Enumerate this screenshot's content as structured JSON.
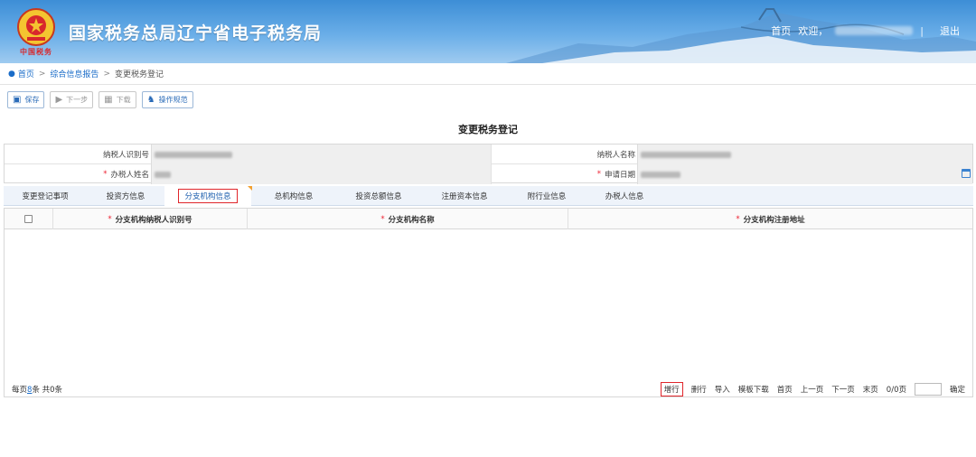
{
  "header": {
    "title": "国家税务总局辽宁省电子税务局",
    "logo_text": "中国税务",
    "home": "首页",
    "welcome": "欢迎，",
    "logout": "退出",
    "separator": "|"
  },
  "breadcrumb": {
    "home": "首页",
    "parent": "综合信息报告",
    "current": "变更税务登记",
    "sep": ">"
  },
  "toolbar": {
    "save": "保存",
    "next": "下一步",
    "download": "下载",
    "guide": "操作规范"
  },
  "form": {
    "title": "变更税务登记",
    "taxpayer_id_label": "纳税人识别号",
    "taxpayer_name_label": "纳税人名称",
    "handler_label": "办税人姓名",
    "apply_date_label": "申请日期",
    "required_mark": "*"
  },
  "tabs": [
    {
      "label": "变更登记事项"
    },
    {
      "label": "投资方信息"
    },
    {
      "label": "分支机构信息"
    },
    {
      "label": "总机构信息"
    },
    {
      "label": "投资总额信息"
    },
    {
      "label": "注册资本信息"
    },
    {
      "label": "附行业信息"
    },
    {
      "label": "办税人信息"
    }
  ],
  "table": {
    "columns": [
      "分支机构纳税人识别号",
      "分支机构名称",
      "分支机构注册地址"
    ]
  },
  "footer": {
    "per_page_prefix": "每页",
    "per_page_value": "8",
    "per_page_suffix": "条 共0条",
    "add_row": "增行",
    "delete_row": "删行",
    "import": "导入",
    "template_download": "模板下载",
    "first_page": "首页",
    "prev_page": "上一页",
    "next_page": "下一页",
    "last_page": "末页",
    "page_count": "0/0页",
    "confirm": "确定"
  }
}
